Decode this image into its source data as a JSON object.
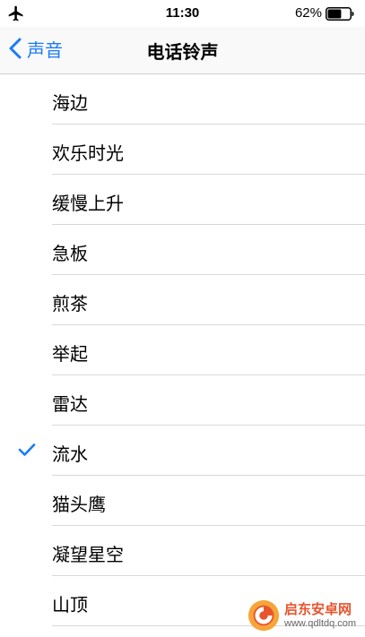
{
  "status_bar": {
    "airplane_icon": "airplane-icon",
    "time": "11:30",
    "battery_percent": "62%",
    "battery_level": 0.62,
    "battery_icon": "battery-icon"
  },
  "nav": {
    "back_label": "声音",
    "back_icon": "chevron-left-icon",
    "title": "电话铃声",
    "accent_color": "#1a7cf7"
  },
  "ringtones": [
    {
      "label": "海边",
      "selected": false
    },
    {
      "label": "欢乐时光",
      "selected": false
    },
    {
      "label": "缓慢上升",
      "selected": false
    },
    {
      "label": "急板",
      "selected": false
    },
    {
      "label": "煎茶",
      "selected": false
    },
    {
      "label": "举起",
      "selected": false
    },
    {
      "label": "雷达",
      "selected": false
    },
    {
      "label": "流水",
      "selected": true
    },
    {
      "label": "猫头鹰",
      "selected": false
    },
    {
      "label": "凝望星空",
      "selected": false
    },
    {
      "label": "山顶",
      "selected": false
    }
  ],
  "check_icon": "checkmark-icon",
  "watermark": {
    "name": "启东安卓网",
    "url": "www.qdltdq.com",
    "logo_icon": "qidong-logo-icon"
  }
}
